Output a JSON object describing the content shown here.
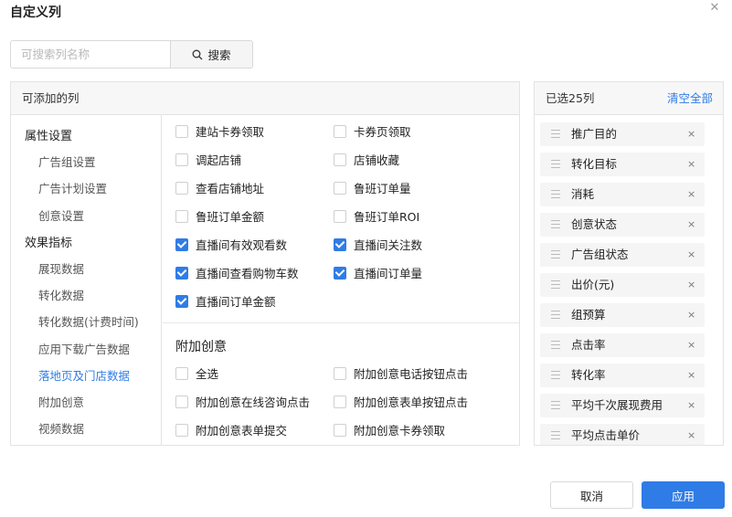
{
  "dialog": {
    "title": "自定义列",
    "close_icon": "close-icon"
  },
  "search": {
    "placeholder": "可搜索列名称",
    "value": "",
    "button_label": "搜索",
    "icon": "search-icon"
  },
  "available": {
    "header": "可添加的列",
    "nav": [
      {
        "label": "属性设置",
        "type": "group"
      },
      {
        "label": "广告组设置",
        "type": "sub"
      },
      {
        "label": "广告计划设置",
        "type": "sub"
      },
      {
        "label": "创意设置",
        "type": "sub"
      },
      {
        "label": "效果指标",
        "type": "group"
      },
      {
        "label": "展现数据",
        "type": "sub"
      },
      {
        "label": "转化数据",
        "type": "sub"
      },
      {
        "label": "转化数据(计费时间)",
        "type": "sub"
      },
      {
        "label": "应用下载广告数据",
        "type": "sub"
      },
      {
        "label": "落地页及门店数据",
        "type": "sub",
        "active": true
      },
      {
        "label": "附加创意",
        "type": "sub"
      },
      {
        "label": "视频数据",
        "type": "sub"
      }
    ],
    "options": [
      {
        "label": "建站卡券领取",
        "checked": false
      },
      {
        "label": "卡券页领取",
        "checked": false
      },
      {
        "label": "调起店铺",
        "checked": false
      },
      {
        "label": "店铺收藏",
        "checked": false
      },
      {
        "label": "查看店铺地址",
        "checked": false
      },
      {
        "label": "鲁班订单量",
        "checked": false
      },
      {
        "label": "鲁班订单金额",
        "checked": false
      },
      {
        "label": "鲁班订单ROI",
        "checked": false
      },
      {
        "label": "直播间有效观看数",
        "checked": true
      },
      {
        "label": "直播间关注数",
        "checked": true
      },
      {
        "label": "直播间查看购物车数",
        "checked": true
      },
      {
        "label": "直播间订单量",
        "checked": true
      },
      {
        "label": "直播间订单金额",
        "checked": true
      }
    ],
    "section2": {
      "title": "附加创意",
      "options": [
        {
          "label": "全选",
          "checked": false
        },
        {
          "label": "附加创意电话按钮点击",
          "checked": false
        },
        {
          "label": "附加创意在线咨询点击",
          "checked": false
        },
        {
          "label": "附加创意表单按钮点击",
          "checked": false
        },
        {
          "label": "附加创意表单提交",
          "checked": false
        },
        {
          "label": "附加创意卡券领取",
          "checked": false
        }
      ]
    }
  },
  "selected": {
    "count_label": "已选25列",
    "clear_label": "清空全部",
    "remove_symbol": "×",
    "items": [
      "推广目的",
      "转化目标",
      "消耗",
      "创意状态",
      "广告组状态",
      "出价(元)",
      "组预算",
      "点击率",
      "转化率",
      "平均千次展现费用",
      "平均点击单价"
    ]
  },
  "footer": {
    "cancel_label": "取消",
    "apply_label": "应用"
  },
  "colors": {
    "accent": "#2f7ce6",
    "panel_header_bg": "#f7f7f7",
    "border": "#e3e3e3"
  }
}
